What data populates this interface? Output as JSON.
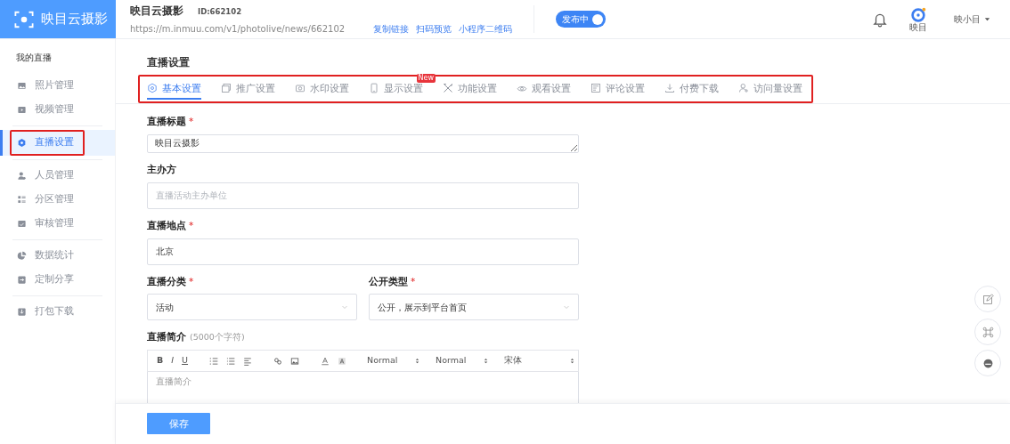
{
  "header": {
    "logo_text": "映目云摄影",
    "site_title": "映目云摄影",
    "site_id": "ID:662102",
    "url": "https://m.inmuu.com/v1/photolive/news/662102",
    "links": [
      "复制链接",
      "扫码预览",
      "小程序二维码"
    ],
    "publish_toggle": {
      "label": "发布中",
      "on": true
    },
    "account": {
      "brand_caption": "映目",
      "user": "映小目"
    }
  },
  "sidebar": {
    "heading": "我的直播",
    "groups": [
      [
        {
          "label": "照片管理",
          "selected": false,
          "highlighted": false
        },
        {
          "label": "视频管理",
          "selected": false,
          "highlighted": false
        }
      ],
      [
        {
          "label": "直播设置",
          "selected": true,
          "highlighted": true
        }
      ],
      [
        {
          "label": "人员管理",
          "selected": false,
          "highlighted": false
        },
        {
          "label": "分区管理",
          "selected": false,
          "highlighted": false
        },
        {
          "label": "审核管理",
          "selected": false,
          "highlighted": false
        }
      ],
      [
        {
          "label": "数据统计",
          "selected": false,
          "highlighted": false
        },
        {
          "label": "定制分享",
          "selected": false,
          "highlighted": false
        }
      ],
      [
        {
          "label": "打包下载",
          "selected": false,
          "highlighted": false
        }
      ]
    ]
  },
  "page_title": "直播设置",
  "tabs_highlighted": true,
  "tabs": [
    {
      "label": "基本设置",
      "selected": true
    },
    {
      "label": "推广设置",
      "selected": false
    },
    {
      "label": "水印设置",
      "selected": false
    },
    {
      "label": "显示设置",
      "selected": false,
      "badge": "New"
    },
    {
      "label": "功能设置",
      "selected": false
    },
    {
      "label": "观看设置",
      "selected": false
    },
    {
      "label": "评论设置",
      "selected": false
    },
    {
      "label": "付费下载",
      "selected": false
    },
    {
      "label": "访问量设置",
      "selected": false
    }
  ],
  "form_rows": [
    [
      {
        "kind": "textarea",
        "label": "直播标题",
        "required_mark": "*",
        "value": "映目云摄影"
      }
    ],
    [
      {
        "kind": "input",
        "label": "主办方",
        "placeholder": "直播活动主办单位"
      }
    ],
    [
      {
        "kind": "input",
        "label": "直播地点",
        "required_mark": "*",
        "value": "北京"
      }
    ],
    [
      {
        "kind": "select",
        "label": "直播分类",
        "required_mark": "*",
        "value": "活动"
      },
      {
        "kind": "select",
        "label": "公开类型",
        "required_mark": "*",
        "value": "公开，展示到平台首页"
      }
    ]
  ],
  "editor": {
    "label": "直播简介",
    "hint": "(5000个字符)",
    "format_buttons": [
      "B",
      "I",
      "U"
    ],
    "selects": [
      "Normal",
      "Normal",
      "宋体"
    ],
    "placeholder": "直播简介"
  },
  "save_button": "保存"
}
